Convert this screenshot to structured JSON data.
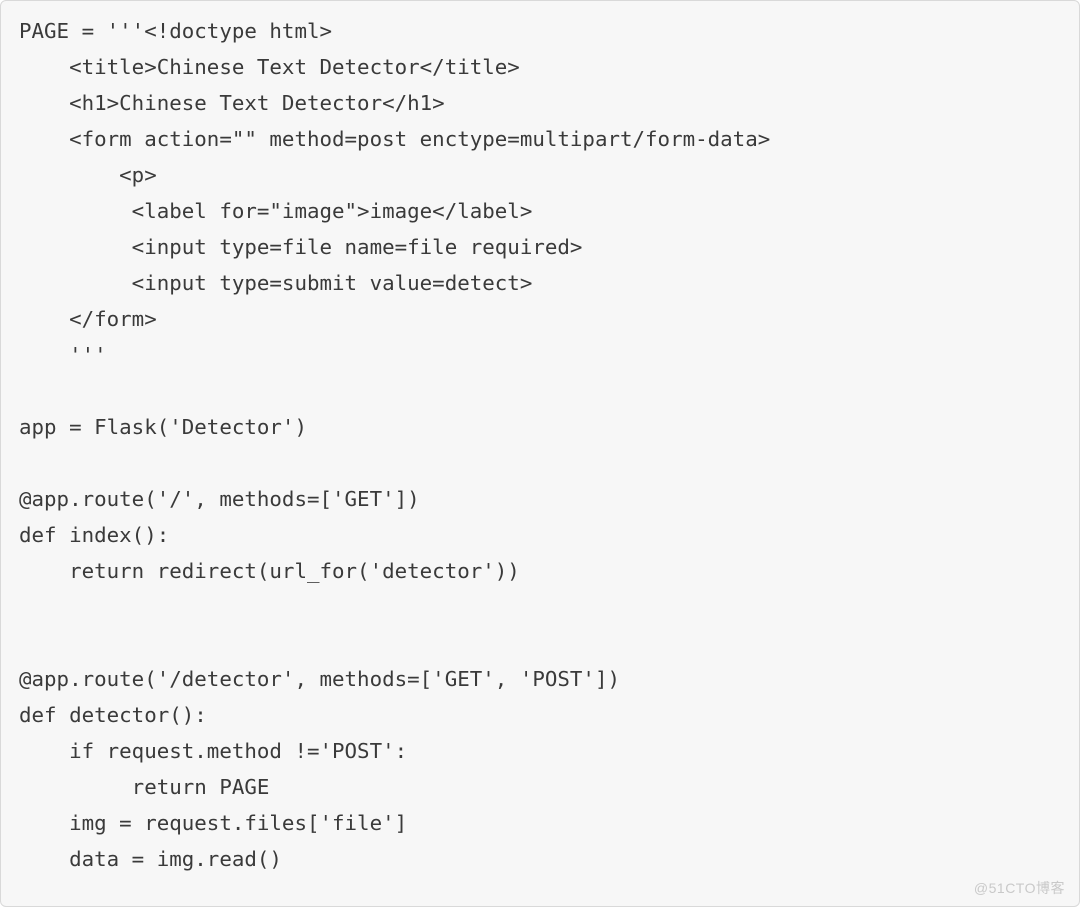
{
  "code": {
    "lines": [
      "PAGE = '''<!doctype html>",
      "    <title>Chinese Text Detector</title>",
      "    <h1>Chinese Text Detector</h1>",
      "    <form action=\"\" method=post enctype=multipart/form-data>",
      "        <p>",
      "         <label for=\"image\">image</label>",
      "         <input type=file name=file required>",
      "         <input type=submit value=detect>",
      "    </form>",
      "    '''",
      "",
      "app = Flask('Detector')",
      "",
      "@app.route('/', methods=['GET'])",
      "def index():",
      "    return redirect(url_for('detector'))",
      "",
      "",
      "@app.route('/detector', methods=['GET', 'POST'])",
      "def detector():",
      "    if request.method !='POST':",
      "         return PAGE",
      "    img = request.files['file']",
      "    data = img.read()"
    ]
  },
  "watermark": "@51CTO博客"
}
